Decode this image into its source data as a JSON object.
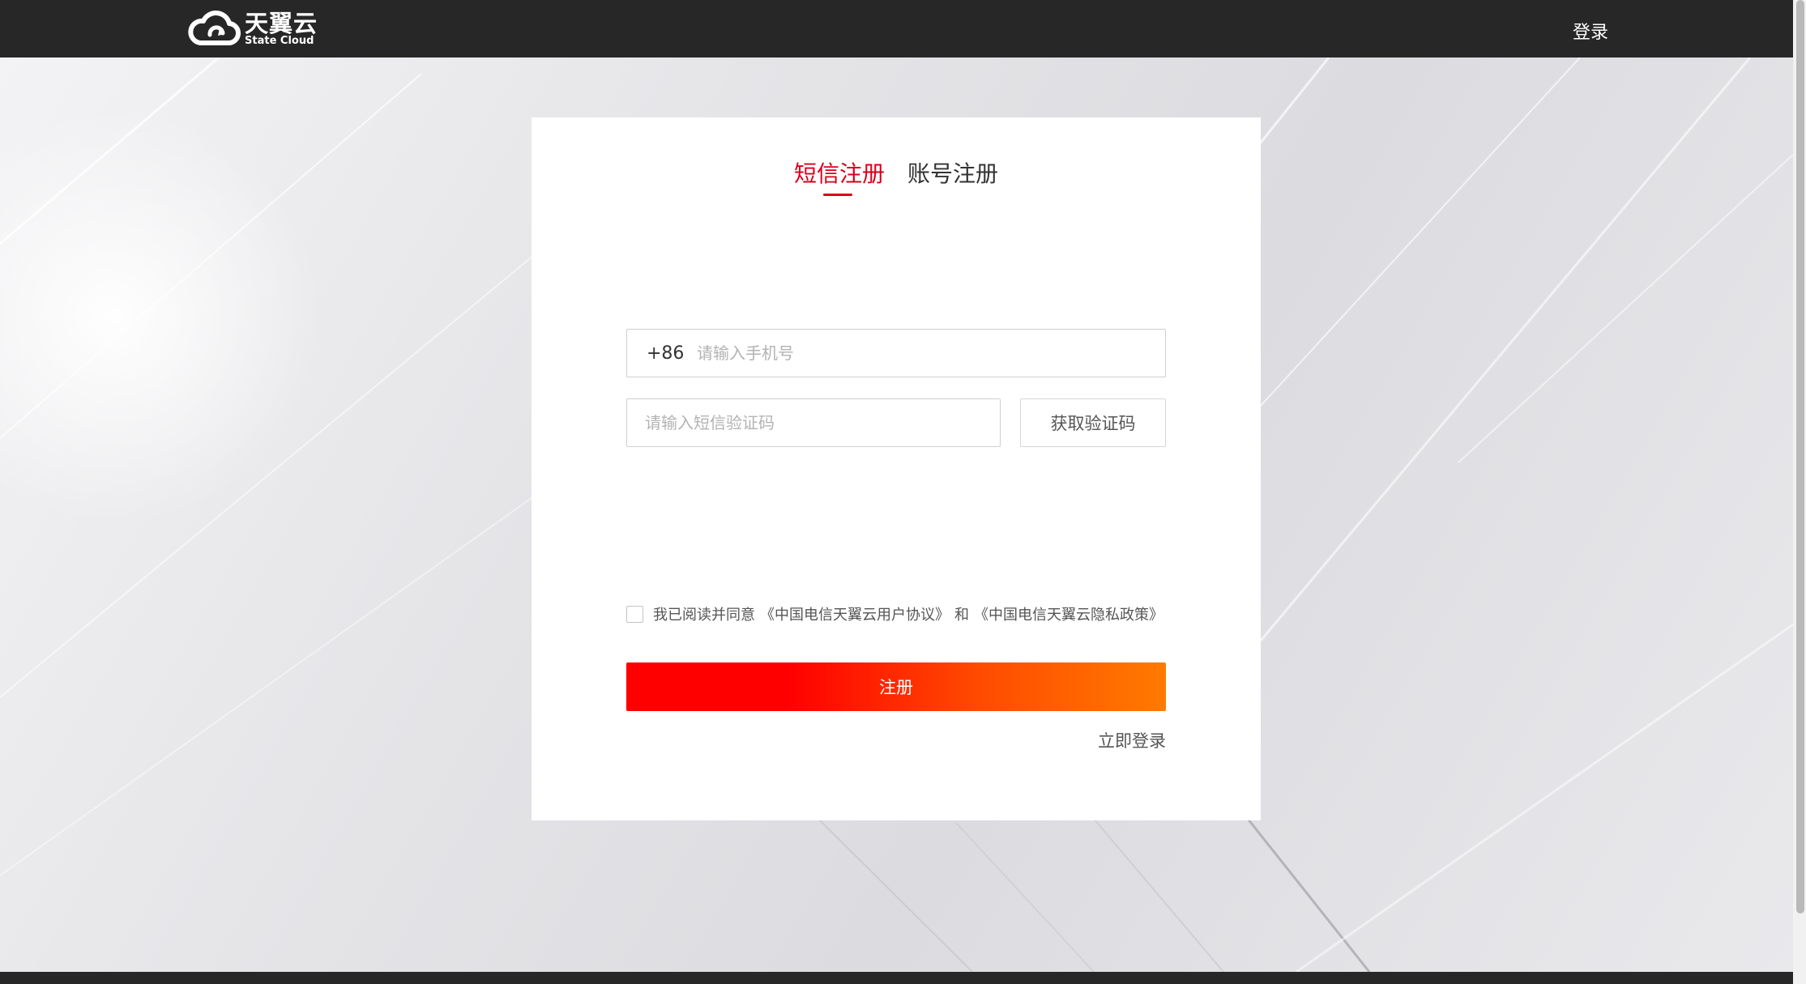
{
  "header": {
    "logo_cn": "天翼云",
    "logo_en": "State Cloud",
    "login_label": "登录"
  },
  "tabs": [
    {
      "label": "短信注册",
      "active": true
    },
    {
      "label": "账号注册",
      "active": false
    }
  ],
  "form": {
    "phone_prefix": "+86",
    "phone_placeholder": "请输入手机号",
    "code_placeholder": "请输入短信验证码",
    "get_code_label": "获取验证码",
    "agree_prefix": "我已阅读并同意",
    "user_agreement": "《中国电信天翼云用户协议》",
    "agree_and": "和",
    "privacy_policy": "《中国电信天翼云隐私政策》",
    "agree_checked": false,
    "register_label": "注册",
    "login_now_label": "立即登录"
  },
  "colors": {
    "accent": "#d9001b",
    "button_start": "#ff0000",
    "button_end": "#ff7a00",
    "topbar": "#272727"
  },
  "icons": {
    "logo": "cloud-logo-icon"
  }
}
